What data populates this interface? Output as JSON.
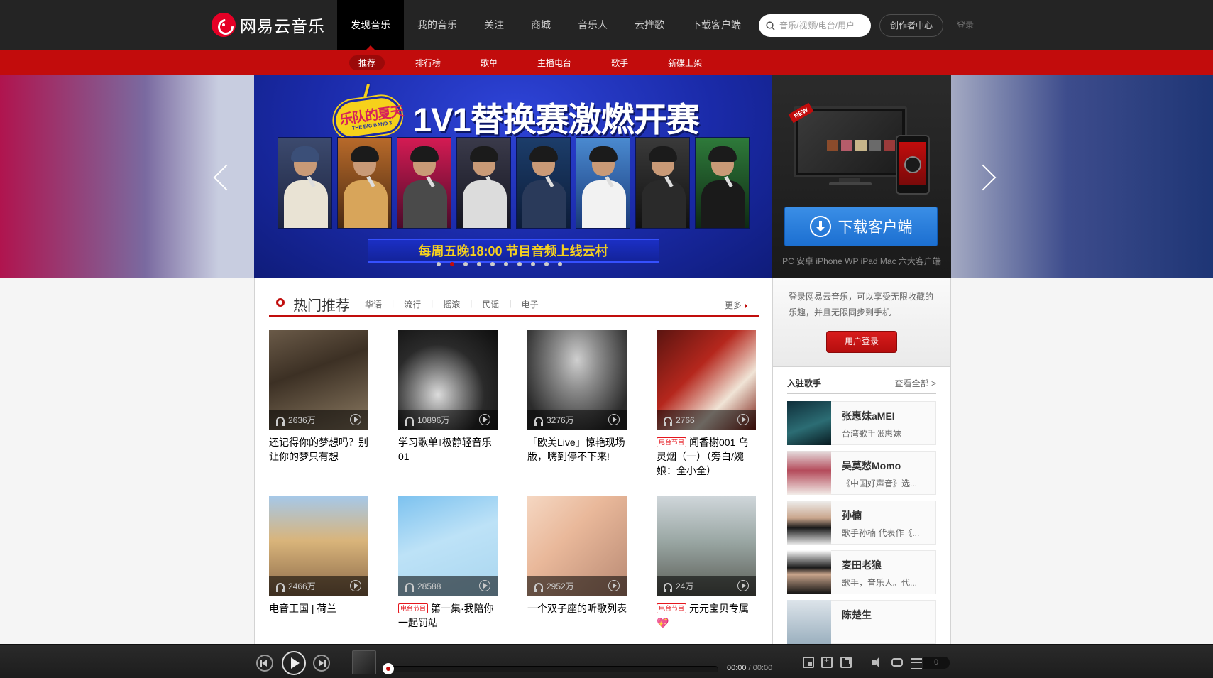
{
  "header": {
    "logo_text": "网易云音乐",
    "nav": [
      {
        "label": "发现音乐",
        "active": true
      },
      {
        "label": "我的音乐",
        "active": false
      },
      {
        "label": "关注",
        "active": false
      },
      {
        "label": "商城",
        "active": false
      },
      {
        "label": "音乐人",
        "active": false
      },
      {
        "label": "云推歌",
        "active": false
      },
      {
        "label": "下载客户端",
        "active": false
      }
    ],
    "search_placeholder": "音乐/视频/电台/用户",
    "creator_label": "创作者中心",
    "login_label": "登录"
  },
  "subnav": [
    {
      "label": "推荐",
      "active": true
    },
    {
      "label": "排行榜",
      "active": false
    },
    {
      "label": "歌单",
      "active": false
    },
    {
      "label": "主播电台",
      "active": false
    },
    {
      "label": "歌手",
      "active": false
    },
    {
      "label": "新碟上架",
      "active": false
    }
  ],
  "banner": {
    "logo_text": "乐队的夏天",
    "logo_sub": "THE BIG BAND 3",
    "title": "1V1替换赛激燃开赛",
    "ribbon": "每周五晚18:00  节目音频上线云村",
    "dot_count": 10,
    "active_dot": 1
  },
  "download": {
    "new_badge": "NEW",
    "button_label": "下载客户端",
    "caption": "PC 安卓 iPhone WP iPad Mac 六大客户端"
  },
  "hot": {
    "title": "热门推荐",
    "tags": [
      "华语",
      "流行",
      "摇滚",
      "民谣",
      "电子"
    ],
    "more": "更多",
    "items": [
      {
        "count": "2636万",
        "title": "还记得你的梦想吗？别让你的梦只有想",
        "radio": false
      },
      {
        "count": "10896万",
        "title": "学习歌单‖极静轻音乐01",
        "radio": false
      },
      {
        "count": "3276万",
        "title": "「欧美Live」惊艳现场版，嗨到停不下来!",
        "radio": false
      },
      {
        "count": "2766",
        "title": "闻香榭001 乌灵烟（一）（旁白/婉娘：全小全）",
        "radio": true
      },
      {
        "count": "2466万",
        "title": "电音王国 | 荷兰",
        "radio": false
      },
      {
        "count": "28588",
        "title": "第一集·我陪你一起罚站",
        "radio": true
      },
      {
        "count": "2952万",
        "title": "一个双子座的听歌列表",
        "radio": false
      },
      {
        "count": "24万",
        "title": "元元宝贝专属",
        "radio": true,
        "heart": "💖"
      }
    ],
    "radio_tag": "电台节目"
  },
  "login_box": {
    "text": "登录网易云音乐，可以享受无限收藏的乐趣，并且无限同步到手机",
    "button": "用户登录"
  },
  "singers": {
    "title": "入驻歌手",
    "more": "查看全部 >",
    "items": [
      {
        "name": "张惠妹aMEI",
        "desc": "台湾歌手张惠妹"
      },
      {
        "name": "吴莫愁Momo",
        "desc": "《中国好声音》选..."
      },
      {
        "name": "孙楠",
        "desc": "歌手孙楠 代表作《..."
      },
      {
        "name": "麦田老狼",
        "desc": "歌手，音乐人。代..."
      },
      {
        "name": "陈楚生",
        "desc": ""
      }
    ]
  },
  "player": {
    "current_time": "00:00",
    "total_time": "/ 00:00",
    "playlist_count": "0",
    "progress": 0
  }
}
